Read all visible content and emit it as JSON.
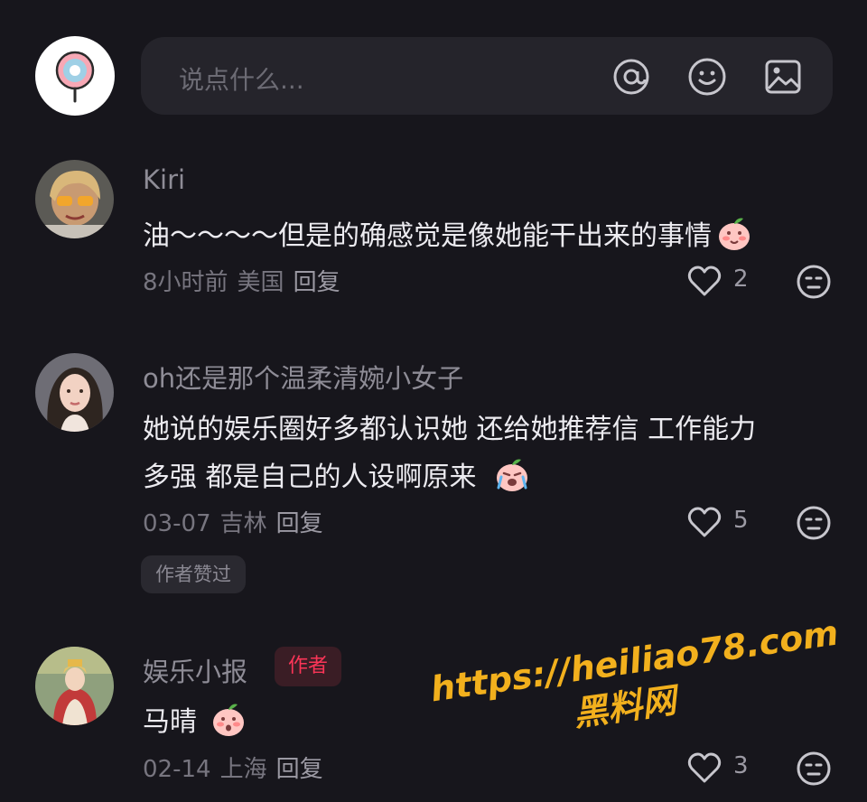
{
  "input": {
    "placeholder": "说点什么..."
  },
  "icons": {
    "my_avatar": "lollipop-logo-icon",
    "mention": "at-sign-icon",
    "emoji": "smiley-icon",
    "image": "image-icon",
    "like": "heart-outline-icon",
    "dislike": "neutral-face-icon",
    "peach_emoji": "peach-sticker-icon"
  },
  "comments": [
    {
      "username": "Kiri",
      "lines": [
        "油～～～～但是的确感觉是像她能干出来的事情"
      ],
      "time": "8小时前",
      "location": "美国",
      "reply": "回复",
      "likes": "2"
    },
    {
      "username": "oh还是那个温柔清婉小女子",
      "lines": [
        "她说的娱乐圈好多都认识她 还给她推荐信 工作能力",
        "多强 都是自己的人设啊原来"
      ],
      "time": "03-07",
      "location": "吉林",
      "reply": "回复",
      "likes": "5",
      "tag": "作者赞过"
    },
    {
      "username": "娱乐小报",
      "badge": "作者",
      "lines": [
        "马晴"
      ],
      "time": "02-14",
      "location": "上海",
      "reply": "回复",
      "likes": "3"
    }
  ],
  "watermark": {
    "url": "https://heiliao78.com",
    "name": "黑料网"
  },
  "colors": {
    "background": "#17161c",
    "input_bg": "#25242b",
    "author_badge": "#fa3557",
    "watermark": "#f2b01d"
  }
}
